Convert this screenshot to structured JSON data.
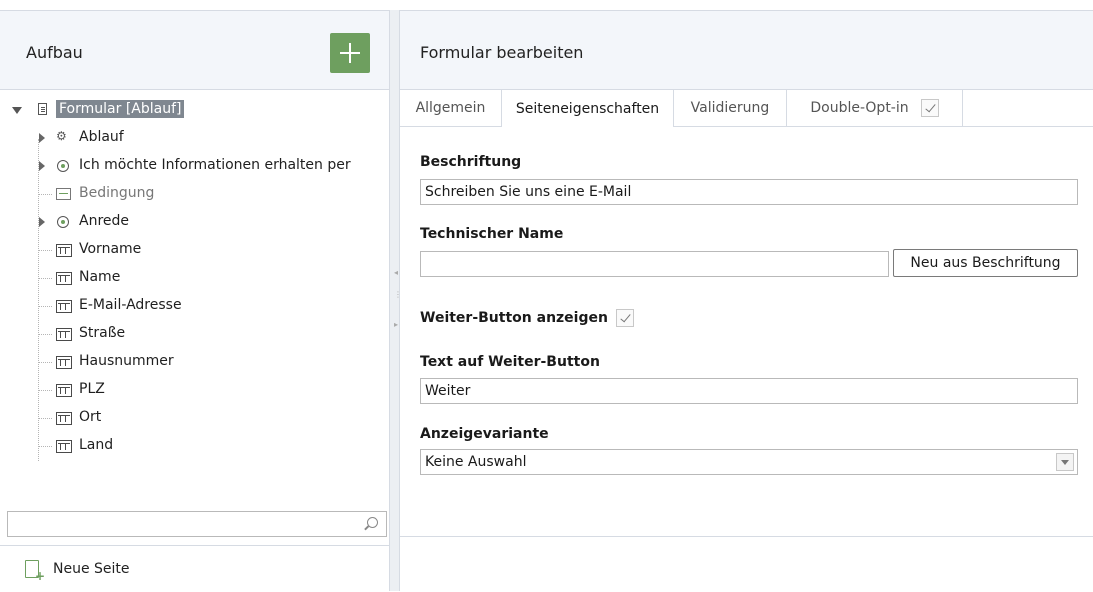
{
  "left": {
    "title": "Aufbau",
    "add_icon": "plus-icon",
    "tree": {
      "root": {
        "label": "Formular [Ablauf]",
        "icon": "form-doc-icon"
      },
      "items": [
        {
          "label": "Ablauf",
          "icon": "gears-icon",
          "expandable": true
        },
        {
          "label": "Ich möchte Informationen erhalten per",
          "icon": "radio-icon",
          "expandable": true
        },
        {
          "label": "Bedingung",
          "icon": "condition-icon",
          "expandable": false
        },
        {
          "label": "Anrede",
          "icon": "radio-icon",
          "expandable": true
        },
        {
          "label": "Vorname",
          "icon": "text-field-icon"
        },
        {
          "label": "Name",
          "icon": "text-field-icon"
        },
        {
          "label": "E-Mail-Adresse",
          "icon": "text-field-icon"
        },
        {
          "label": "Straße",
          "icon": "text-field-icon"
        },
        {
          "label": "Hausnummer",
          "icon": "text-field-icon"
        },
        {
          "label": "PLZ",
          "icon": "text-field-icon"
        },
        {
          "label": "Ort",
          "icon": "text-field-icon"
        },
        {
          "label": "Land",
          "icon": "text-field-icon"
        }
      ]
    },
    "search": {
      "value": "",
      "placeholder": ""
    },
    "new_page_label": "Neue Seite"
  },
  "right": {
    "title": "Formular bearbeiten",
    "tabs": [
      "Allgemein",
      "Seiteneigenschaften",
      "Validierung",
      "Double-Opt-in"
    ],
    "active_tab": "Seiteneigenschaften",
    "form": {
      "caption_label": "Beschriftung",
      "caption_value": "Schreiben Sie uns eine E-Mail",
      "tech_name_label": "Technischer Name",
      "tech_name_value": "",
      "from_caption_button": "Neu aus Beschriftung",
      "show_next_label": "Weiter-Button anzeigen",
      "show_next_checked": true,
      "next_text_label": "Text auf Weiter-Button",
      "next_text_value": "Weiter",
      "variant_label": "Anzeigevariante",
      "variant_value": "Keine Auswahl"
    }
  },
  "colors": {
    "accent_green": "#6e9f5f",
    "header_bg": "#f3f6fa",
    "selection_bg": "#7f8790",
    "border": "#d6dbe3"
  }
}
